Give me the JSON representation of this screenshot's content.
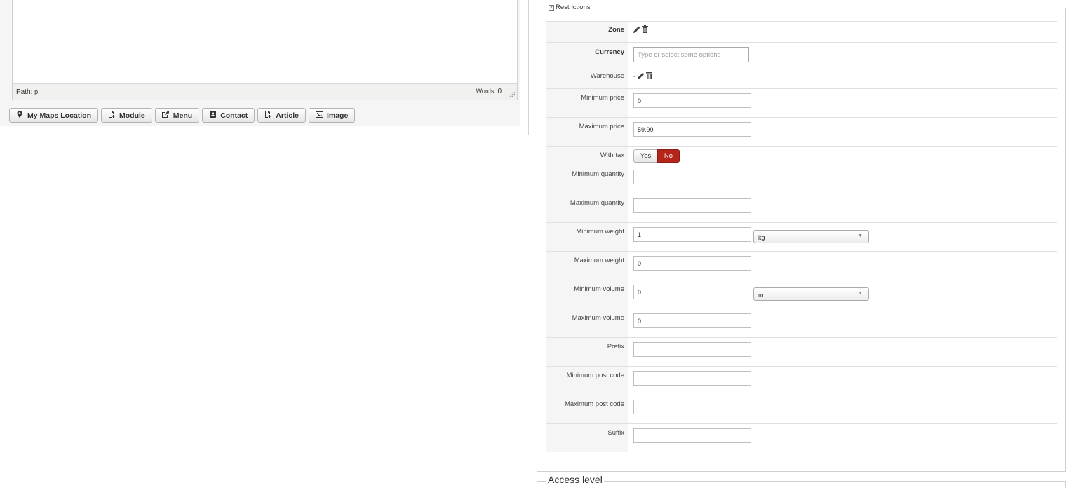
{
  "editor": {
    "path_label": "Path:",
    "path_value": "p",
    "words_label": "Words:",
    "words_count": "0"
  },
  "buttons": [
    {
      "label": "My Maps Location",
      "icon": "map-pin-icon"
    },
    {
      "label": "Module",
      "icon": "file-add-icon"
    },
    {
      "label": "Menu",
      "icon": "share-icon"
    },
    {
      "label": "Contact",
      "icon": "address-book-icon"
    },
    {
      "label": "Article",
      "icon": "file-add-icon"
    },
    {
      "label": "Image",
      "icon": "picture-icon"
    }
  ],
  "restrictions": {
    "legend": "Restrictions",
    "checked": true,
    "zone": {
      "label": "Zone"
    },
    "currency": {
      "label": "Currency",
      "placeholder": "Type or select some options"
    },
    "warehouse": {
      "label": "Warehouse",
      "value": "-"
    },
    "minimum_price": {
      "label": "Minimum price",
      "value": "0"
    },
    "maximum_price": {
      "label": "Maximum price",
      "value": "59.99"
    },
    "with_tax": {
      "label": "With tax",
      "yes": "Yes",
      "no": "No",
      "selected": "No",
      "selected_color": "#b52519"
    },
    "minimum_quantity": {
      "label": "Minimum quantity",
      "value": ""
    },
    "maximum_quantity": {
      "label": "Maximum quantity",
      "value": ""
    },
    "minimum_weight": {
      "label": "Minimum weight",
      "value": "1",
      "unit": "kg"
    },
    "maximum_weight": {
      "label": "Maximum weight",
      "value": "0"
    },
    "minimum_volume": {
      "label": "Minimum volume",
      "value": "0",
      "unit": "m"
    },
    "maximum_volume": {
      "label": "Maximum volume",
      "value": "0"
    },
    "prefix": {
      "label": "Prefix",
      "value": ""
    },
    "minimum_post_code": {
      "label": "Minimum post code",
      "value": ""
    },
    "maximum_post_code": {
      "label": "Maximum post code",
      "value": ""
    },
    "suffix": {
      "label": "Suffix",
      "value": ""
    }
  },
  "access_level": {
    "legend": "Access level"
  }
}
